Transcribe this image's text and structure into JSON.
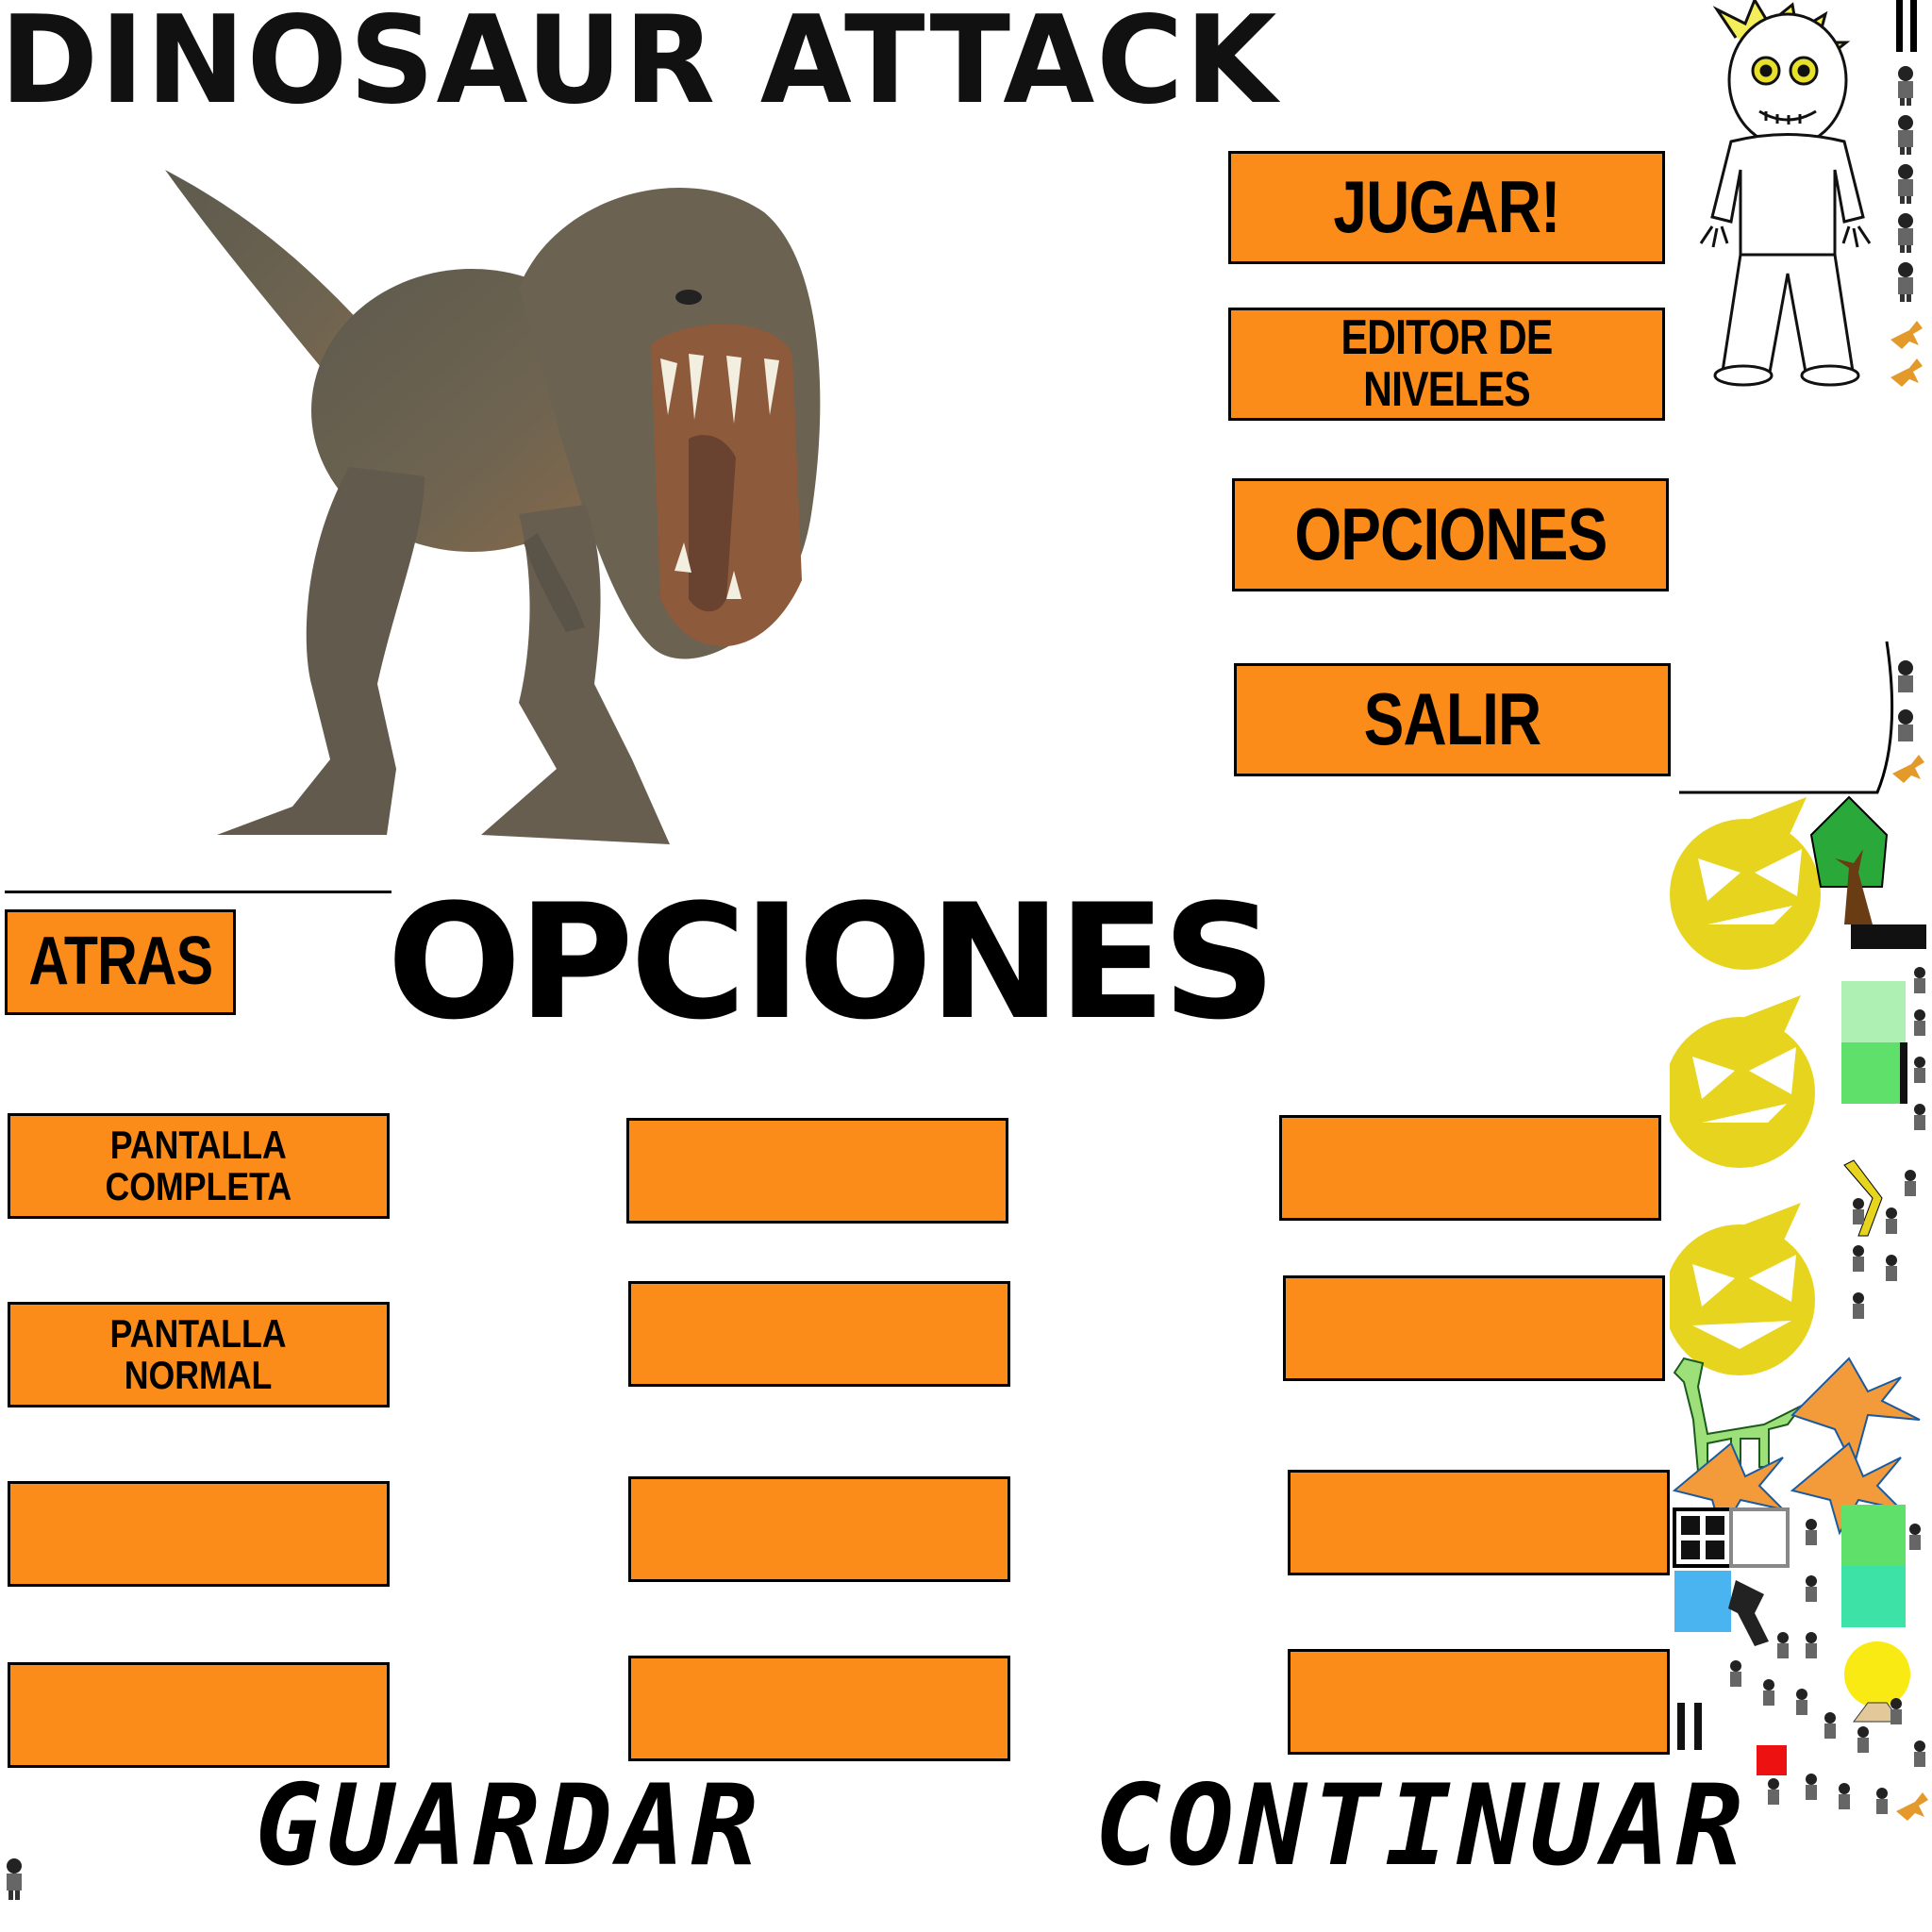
{
  "header": {
    "title": "DINOSAUR ATTACK"
  },
  "main_menu": {
    "play": "JUGAR!",
    "level_editor": "EDITOR DE NIVELES",
    "options": "OPCIONES",
    "exit": "SALIR"
  },
  "options_screen": {
    "back": "ATRAS",
    "heading": "OPCIONES",
    "fullscreen_line1": "PANTALLA",
    "fullscreen_line2": "COMPLETA",
    "normal_line1": "PANTALLA",
    "normal_line2": "NORMAL",
    "empty_slots": [
      "",
      "",
      "",
      "",
      "",
      "",
      "",
      "",
      "",
      ""
    ]
  },
  "footer": {
    "save": "GUARDAR",
    "continue": "CONTINUAR"
  },
  "colors": {
    "button": "#fb8c19",
    "border": "#000000",
    "sun": "#e6d41e",
    "pterodactyl": "#f39a3a",
    "grass": "#5ee06a"
  },
  "icons": [
    "trex-image",
    "character-sprite",
    "angry-sun-icon",
    "tree-icon",
    "pterodactyl-icon",
    "brontosaurus-icon",
    "soldier-icon",
    "window-icon",
    "water-tile-icon",
    "grass-tile-icon",
    "pistol-icon",
    "lamp-icon",
    "pause-icon"
  ]
}
